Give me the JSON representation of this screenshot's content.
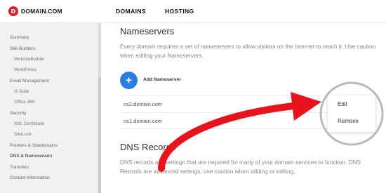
{
  "header": {
    "logo_letter": "D",
    "logo_text": "DOMAIN.COM",
    "nav": [
      "DOMAINS",
      "HOSTING"
    ]
  },
  "sidebar": {
    "items": [
      {
        "label": "Summary"
      },
      {
        "label": "Site Builders"
      },
      {
        "label": "WebsiteBuilder"
      },
      {
        "label": "WordPress"
      },
      {
        "label": "Email Management"
      },
      {
        "label": "G Suite"
      },
      {
        "label": "Office 365"
      },
      {
        "label": "Security"
      },
      {
        "label": "SSL Certificate"
      },
      {
        "label": "SiteLock"
      },
      {
        "label": "Pointers & Subdomains"
      },
      {
        "label": "DNS & Nameservers"
      },
      {
        "label": "Transfers"
      },
      {
        "label": "Contact Information"
      }
    ]
  },
  "nameservers": {
    "title": "Nameservers",
    "description": "Every domain requires a set of nameservers to allow visitors on the Internet to reach it. Use caution when editing your Nameservers.",
    "add_label": "Add Nameserver",
    "add_icon": "+",
    "rows": [
      "ns2.domain.com",
      "ns1.domain.com"
    ]
  },
  "dns": {
    "title": "DNS Records",
    "description": "DNS records are settings that are required for many of your domain services to function. DNS Records are advanced settings, use caution when adding or editing."
  },
  "menu": {
    "edit": "Edit",
    "remove": "Remove"
  },
  "colors": {
    "brand": "#d6202f",
    "accent": "#2b7de1",
    "annotation_arrow": "#e8141d"
  }
}
